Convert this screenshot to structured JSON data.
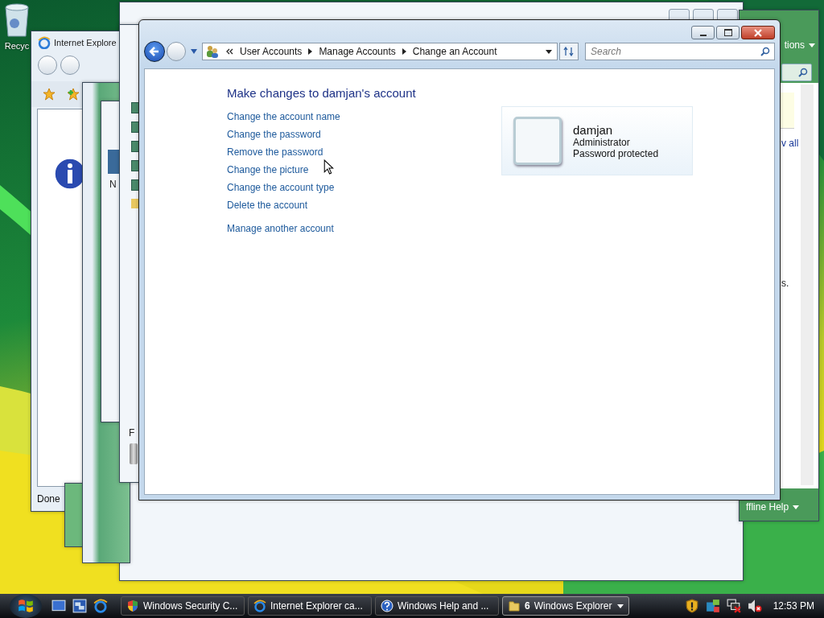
{
  "desktop_icons": [
    {
      "label": "Recyc"
    }
  ],
  "ie_window": {
    "title": "Internet Explore",
    "status": "Done"
  },
  "explorer_window": {
    "fragments": [
      "N",
      "F"
    ]
  },
  "help_window": {
    "options": "tions",
    "link": "v all",
    "text": "s.",
    "footer": "ffline Help"
  },
  "window": {
    "breadcrumb": [
      "User Accounts",
      "Manage Accounts",
      "Change an Account"
    ],
    "search": {
      "placeholder": "Search"
    },
    "heading": "Make changes to damjan's account",
    "links": [
      "Change the account name",
      "Change the password",
      "Remove the password",
      "Change the picture",
      "Change the account type",
      "Delete the account"
    ],
    "other_links": [
      "Manage another account"
    ],
    "account": {
      "name": "damjan",
      "type": "Administrator",
      "status": "Password protected"
    }
  },
  "taskbar": {
    "buttons": [
      {
        "label": "Windows Security C...",
        "kind": "security",
        "selected": false
      },
      {
        "label": "Internet Explorer ca...",
        "kind": "ie",
        "selected": false
      },
      {
        "label": "Windows Help and ...",
        "kind": "help",
        "selected": false
      },
      {
        "label": "Windows Explorer",
        "count": "6",
        "kind": "folder",
        "selected": true
      }
    ],
    "clock": "12:53 PM"
  }
}
